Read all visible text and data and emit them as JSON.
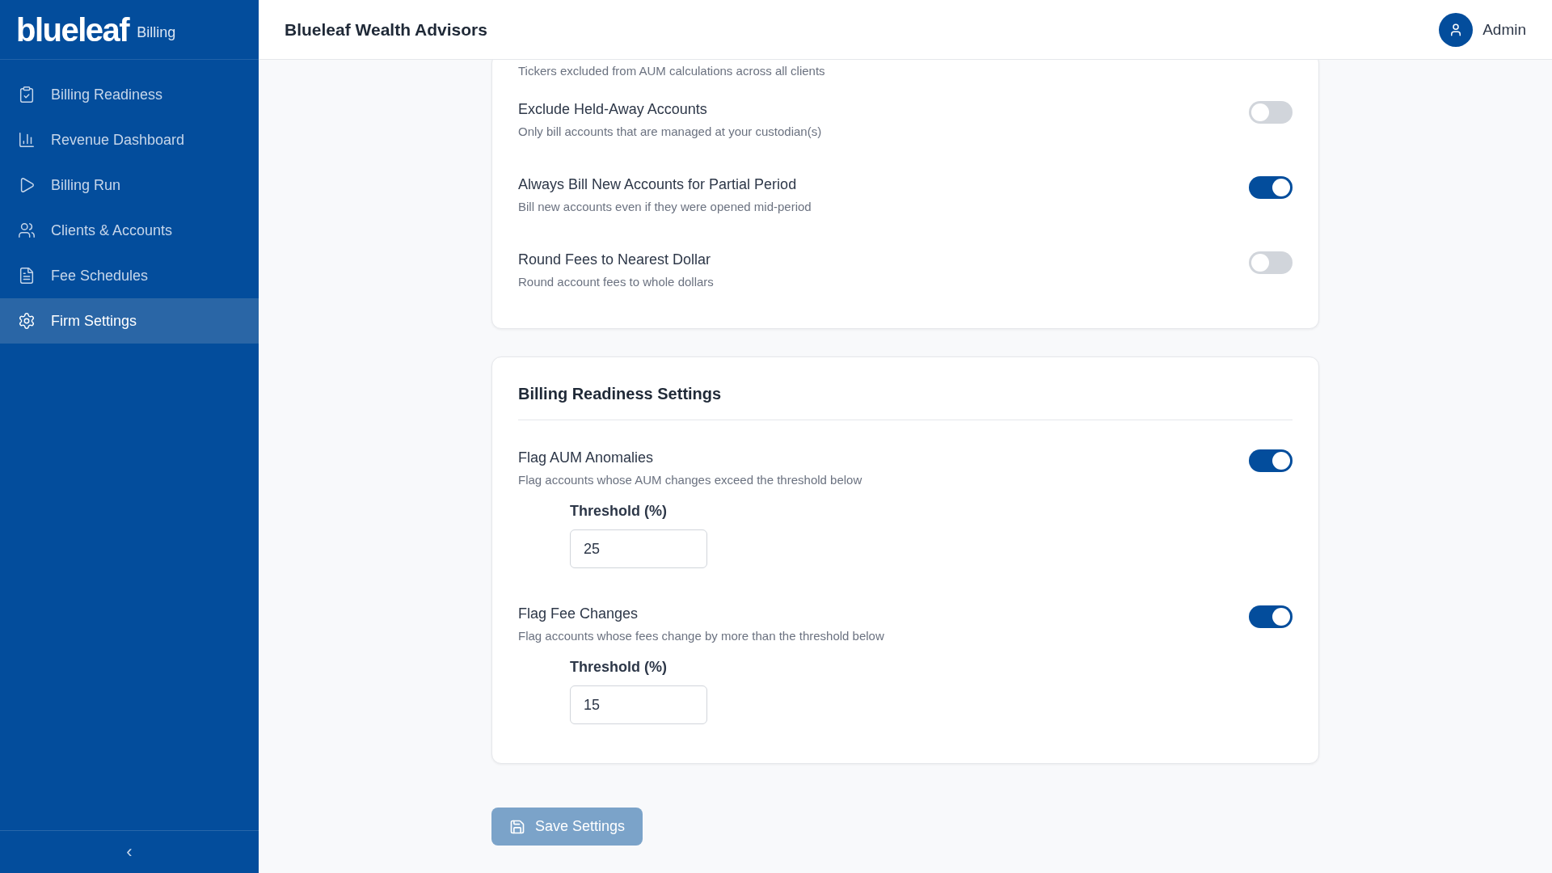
{
  "sidebar": {
    "logo": "blueleaf",
    "product": "Billing",
    "items": [
      {
        "label": "Billing Readiness",
        "selected": false
      },
      {
        "label": "Revenue Dashboard",
        "selected": false
      },
      {
        "label": "Billing Run",
        "selected": false
      },
      {
        "label": "Clients & Accounts",
        "selected": false
      },
      {
        "label": "Fee Schedules",
        "selected": false
      },
      {
        "label": "Firm Settings",
        "selected": true
      }
    ],
    "collapse": "‹"
  },
  "header": {
    "title": "Blueleaf Wealth Advisors",
    "user": "Admin"
  },
  "cards": [
    {
      "partial_text": "Tickers excluded from AUM calculations across all clients",
      "settings": [
        {
          "label": "Exclude Held-Away Accounts",
          "description": "Only bill accounts that are managed at your custodian(s)",
          "on": false
        },
        {
          "label": "Always Bill New Accounts for Partial Period",
          "description": "Bill new accounts even if they were opened mid-period",
          "on": true
        },
        {
          "label": "Round Fees to Nearest Dollar",
          "description": "Round account fees to whole dollars",
          "on": false
        }
      ]
    },
    {
      "title": "Billing Readiness Settings",
      "settings": [
        {
          "label": "Flag AUM Anomalies",
          "description": "Flag accounts whose AUM changes exceed the threshold below",
          "on": true,
          "threshold": {
            "label": "Threshold (%)",
            "value": "25"
          }
        },
        {
          "label": "Flag Fee Changes",
          "description": "Flag accounts whose fees change by more than the threshold below",
          "on": true,
          "threshold": {
            "label": "Threshold (%)",
            "value": "15"
          }
        }
      ]
    }
  ],
  "save_button": "Save Settings"
}
